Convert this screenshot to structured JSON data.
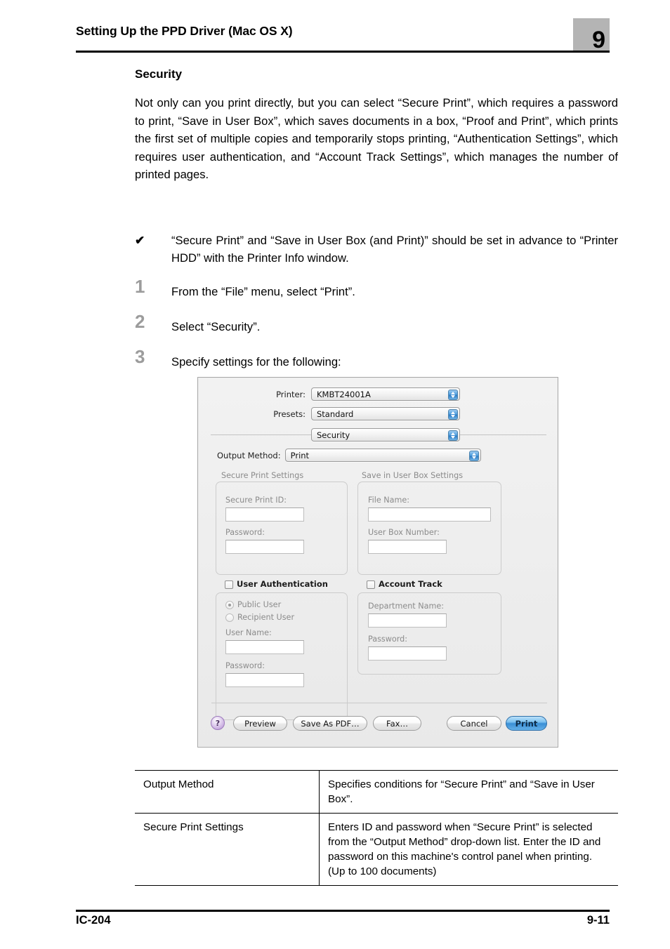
{
  "header": {
    "title": "Setting Up the PPD Driver (Mac OS X)",
    "chapter_number": "9",
    "badge_color": "#b4b4b4"
  },
  "section": {
    "title": "Security",
    "paragraph": "Not only can you print directly, but you can select “Secure Print”, which requires a password to print, “Save in User Box”, which saves documents in a box, “Proof and Print”, which prints the first set of multiple copies and temporarily stops printing, “Authentication Settings”, which requires user authentication, and “Account Track Settings”, which manages the number of printed pages."
  },
  "note": {
    "mark": "✔",
    "text": "“Secure Print” and “Save in User Box (and Print)” should be set in advance to “Printer HDD” with the Printer Info window."
  },
  "steps": [
    {
      "number": "1",
      "text": "From the “File” menu, select “Print”."
    },
    {
      "number": "2",
      "text": "Select “Security”."
    },
    {
      "number": "3",
      "text": "Specify settings for the following:"
    }
  ],
  "dialog": {
    "printer_label": "Printer:",
    "printer_value": "KMBT24001A",
    "presets_label": "Presets:",
    "presets_value": "Standard",
    "pane_value": "Security",
    "output_method_label": "Output Method:",
    "output_method_value": "Print",
    "secure_print": {
      "group_title": "Secure Print Settings",
      "id_label": "Secure Print ID:",
      "id_value": "",
      "password_label": "Password:",
      "password_value": ""
    },
    "user_box": {
      "group_title": "Save in User Box Settings",
      "file_name_label": "File Name:",
      "file_name_value": "",
      "box_number_label": "User Box Number:",
      "box_number_value": ""
    },
    "user_auth": {
      "checkbox_label": "User Authentication",
      "checked": false,
      "radio_public": "Public User",
      "radio_recipient": "Recipient User",
      "selected_radio": "Public User",
      "user_name_label": "User Name:",
      "user_name_value": "",
      "password_label": "Password:",
      "password_value": ""
    },
    "account_track": {
      "checkbox_label": "Account Track",
      "checked": false,
      "department_label": "Department Name:",
      "department_value": "",
      "password_label": "Password:",
      "password_value": ""
    },
    "buttons": {
      "help": "?",
      "preview": "Preview",
      "save_as_pdf": "Save As PDF…",
      "fax": "Fax…",
      "cancel": "Cancel",
      "print": "Print",
      "print_accent_color": "#3a8fd6"
    }
  },
  "table": {
    "rows": [
      {
        "term": "Output Method",
        "description": "Specifies conditions for “Secure Print” and “Save in User Box”."
      },
      {
        "term": "Secure Print Settings",
        "description": "Enters ID and password when “Secure Print” is selected from the “Output Method” drop-down list. Enter the ID and password on this machine's control panel when printing. (Up to 100 documents)"
      }
    ]
  },
  "footer": {
    "left": "IC-204",
    "right": "9-11"
  }
}
